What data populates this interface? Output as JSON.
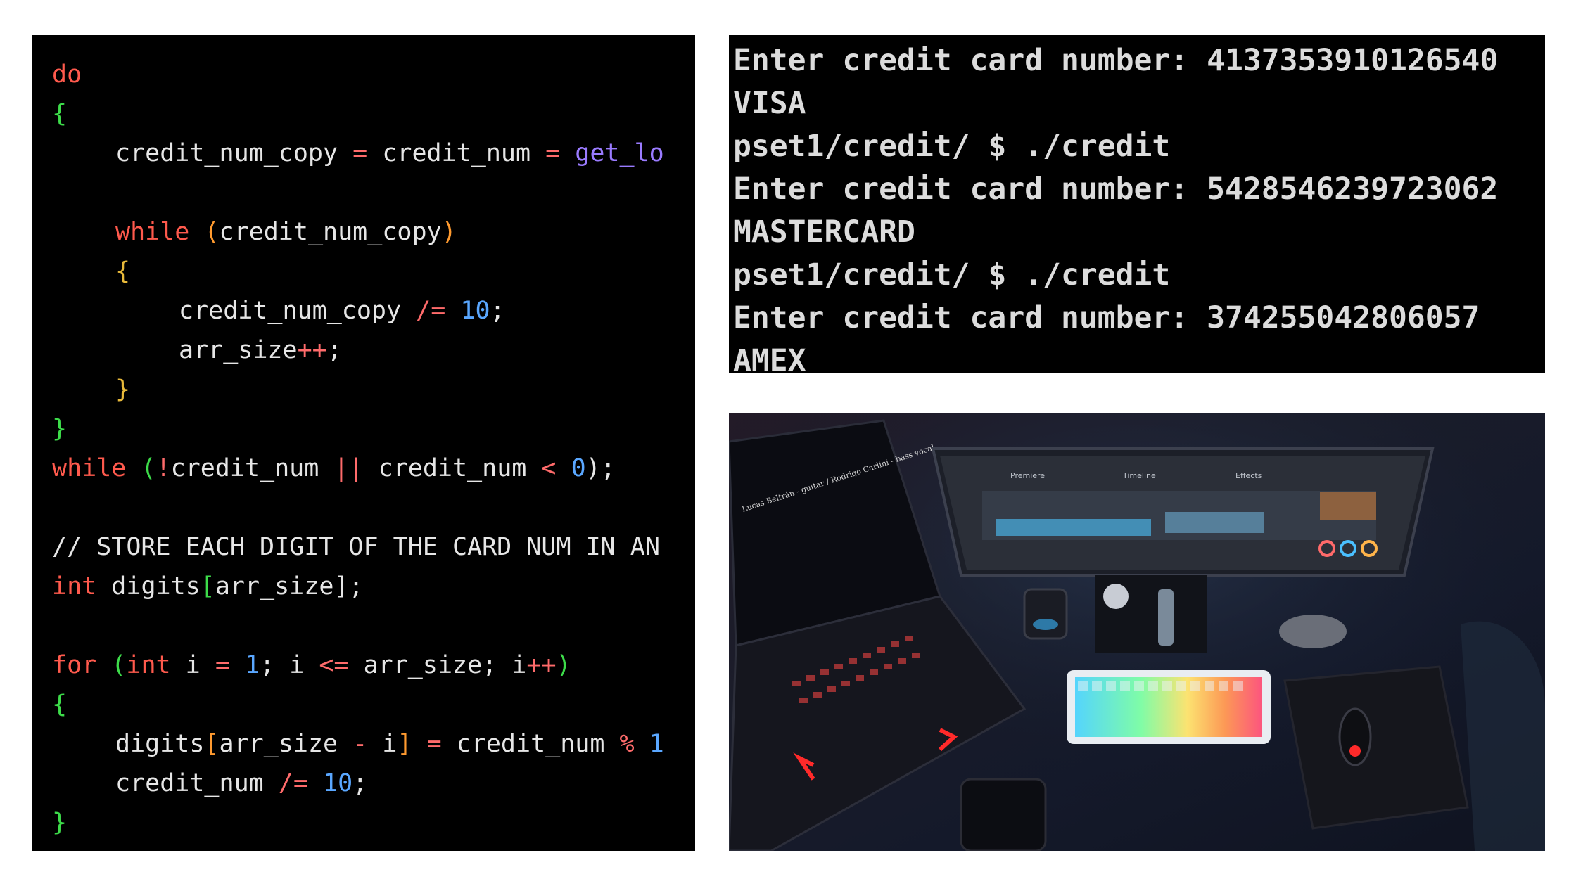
{
  "code_panel": {
    "lines": [
      "do",
      "{",
      "credit_num_copy",
      "=",
      "credit_num",
      "=",
      "get_lo",
      "while",
      "(",
      "credit_num_copy",
      ")",
      "{",
      "credit_num_copy",
      "/=",
      "10",
      ";",
      "arr_size",
      "++",
      ";",
      "}",
      "}",
      "while",
      "(",
      "!",
      "credit_num",
      "||",
      "credit_num",
      "<",
      "0",
      ");",
      "// STORE EACH DIGIT OF THE CARD NUM IN AN",
      "int",
      "digits",
      "[",
      "arr_size",
      "];",
      "for",
      "(",
      "int",
      "i",
      "=",
      "1",
      "; i",
      "<=",
      "arr_size; i",
      "++",
      ")",
      "{",
      "digits",
      "[",
      "arr_size",
      "-",
      "i",
      "]",
      "=",
      "credit_num",
      "%",
      "1",
      "credit_num",
      "/=",
      "10",
      ";",
      "}"
    ]
  },
  "terminal": {
    "lines": [
      "Enter credit card number: 4137353910126540",
      "VISA",
      "pset1/credit/ $ ./credit",
      "Enter credit card number: 5428546239723062",
      "MASTERCARD",
      "pset1/credit/ $ ./credit",
      "Enter credit card number: 374255042806057",
      "AMEX"
    ]
  },
  "photo": {
    "monitor_text": "Lucas Beltrán - guitar / Rodrigo Carlini - bass vocal",
    "screen_labels": [
      "Premiere",
      "Timeline",
      "Effects"
    ]
  },
  "colors": {
    "code_bg": "#000000",
    "keyword": "#ff5a4d",
    "number": "#5aa7ff",
    "function": "#9a7bff",
    "brace": "#3ddc4a"
  }
}
